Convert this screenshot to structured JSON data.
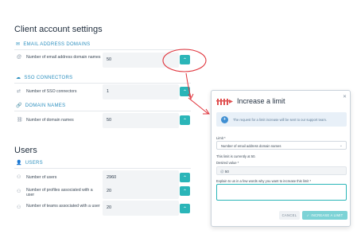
{
  "client_settings": {
    "title": "Client account settings",
    "email_section": "EMAIL ADDRESS DOMAINS",
    "email_row_label": "Number of email address domain names",
    "email_row_value": "50",
    "sso_section": "SSO CONNECTORS",
    "sso_row_label": "Number of SSO connectors",
    "sso_row_value": "1",
    "domain_section": "DOMAIN NAMES",
    "domain_row_label": "Number of domain names",
    "domain_row_value": "50"
  },
  "users": {
    "title": "Users",
    "section": "USERS",
    "rows": [
      {
        "label": "Number of users",
        "value": "2960"
      },
      {
        "label": "Number of profiles associated with a user",
        "value": "20"
      },
      {
        "label": "Number of teams associated with a user",
        "value": "20"
      }
    ]
  },
  "modal": {
    "title": "Increase a limit",
    "info_text": "The request for a limit increase will be sent to our support team.",
    "limit_label": "Limit *",
    "limit_value": "Number of email address domain names",
    "current_text": "This limit is currently at 50.",
    "desired_label": "Desired value *",
    "desired_value": "50",
    "explain_label": "Explain to us in a few words why you want to increase this limit *",
    "cancel_label": "CANCEL",
    "increase_label": "INCREASE A LIMIT"
  },
  "colors": {
    "accent": "#2ab5b8",
    "section": "#2c8fbf",
    "annotation": "#e0323a"
  }
}
